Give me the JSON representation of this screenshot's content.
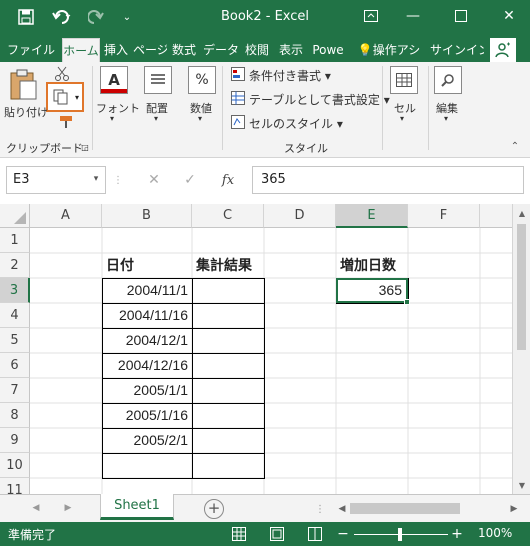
{
  "window": {
    "title": "Book2 - Excel",
    "minimize_icon": "minimize-icon",
    "restore_icon": "ribbon-display-icon",
    "maximize_icon": "maximize-icon",
    "close_icon": "close-icon"
  },
  "quick_access": [
    "save-icon",
    "undo-icon",
    "redo-icon",
    "customize-icon"
  ],
  "tabs": [
    {
      "label": "ファイル",
      "active": false
    },
    {
      "label": "ホーム",
      "active": true
    },
    {
      "label": "挿入",
      "active": false
    },
    {
      "label": "ページ",
      "active": false
    },
    {
      "label": "数式",
      "active": false
    },
    {
      "label": "データ",
      "active": false
    },
    {
      "label": "校閲",
      "active": false
    },
    {
      "label": "表示",
      "active": false
    },
    {
      "label": "Powe",
      "active": false
    }
  ],
  "tell_me": {
    "label": "操作アシ"
  },
  "signin": {
    "label": "サインイン"
  },
  "ribbon": {
    "paste_label": "貼り付け",
    "clipboard_group": "クリップボード",
    "font_label": "フォント",
    "alignment_label": "配置",
    "number_label": "数値",
    "conditional_format": "条件付き書式",
    "format_as_table": "テーブルとして書式設定",
    "cell_styles": "セルのスタイル",
    "styles_group": "スタイル",
    "cells_label": "セル",
    "editing_label": "編集"
  },
  "formula_bar": {
    "name_box": "E3",
    "formula": "365",
    "fx_label": "fx"
  },
  "columns": [
    "A",
    "B",
    "C",
    "D",
    "E",
    "F"
  ],
  "rows": [
    "1",
    "2",
    "3",
    "4",
    "5",
    "6",
    "7",
    "8",
    "9",
    "10",
    "11"
  ],
  "cells": {
    "B2": "日付",
    "C2": "集計結果",
    "E2": "増加日数",
    "E3": "365",
    "B3": "2004/11/1",
    "B4": "2004/11/16",
    "B5": "2004/12/1",
    "B6": "2004/12/16",
    "B7": "2005/1/1",
    "B8": "2005/1/16",
    "B9": "2005/2/1"
  },
  "sheet": {
    "name": "Sheet1",
    "add_label": "+"
  },
  "status": {
    "ready": "準備完了",
    "zoom": "100%"
  },
  "colors": {
    "excel_green": "#217346",
    "selection": "#217346",
    "highlight_border": "#e0762b"
  }
}
